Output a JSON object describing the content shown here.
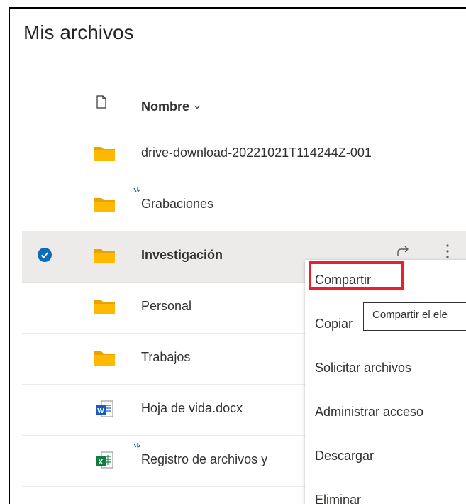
{
  "page_title": "Mis archivos",
  "column_header": {
    "name_label": "Nombre"
  },
  "rows": [
    {
      "name": "drive-download-20221021T114244Z-001",
      "type": "folder"
    },
    {
      "name": "Grabaciones",
      "type": "folder",
      "syncing": true
    },
    {
      "name": "Investigación",
      "type": "folder",
      "selected": true
    },
    {
      "name": "Personal",
      "type": "folder"
    },
    {
      "name": "Trabajos",
      "type": "folder"
    },
    {
      "name": "Hoja de vida.docx",
      "type": "word"
    },
    {
      "name": "Registro de archivos y",
      "type": "excel",
      "syncing": true
    }
  ],
  "context_menu": {
    "items": [
      "Compartir",
      "Copiar",
      "Solicitar archivos",
      "Administrar acceso",
      "Descargar",
      "Eliminar"
    ],
    "highlighted": "Compartir"
  },
  "tooltip": "Compartir el ele",
  "colors": {
    "folder": "#ffb900",
    "folder_back": "#e8a300",
    "check": "#0f6cbd",
    "highlight": "#e8212d",
    "word": "#185abd",
    "excel": "#107c41"
  }
}
